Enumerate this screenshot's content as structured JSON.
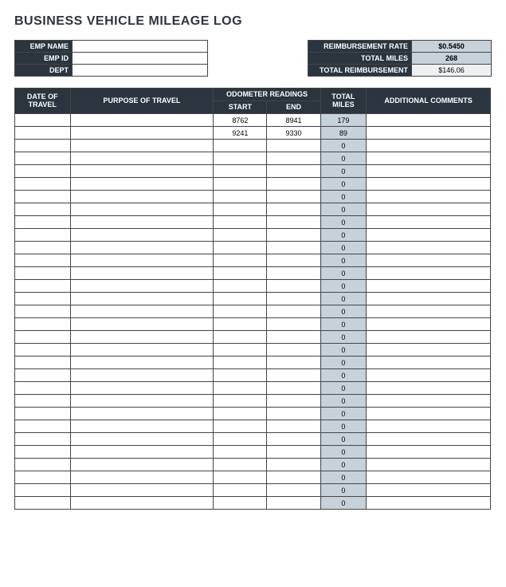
{
  "title": "BUSINESS VEHICLE MILEAGE LOG",
  "emp": {
    "name_label": "EMP NAME",
    "id_label": "EMP ID",
    "dept_label": "DEPT",
    "name": "",
    "id": "",
    "dept": ""
  },
  "reimb": {
    "rate_label": "REIMBURSEMENT RATE",
    "miles_label": "TOTAL MILES",
    "total_label": "TOTAL REIMBURSEMENT",
    "rate": "$0.5450",
    "miles": "268",
    "total": "$146.06"
  },
  "headers": {
    "date": "DATE OF TRAVEL",
    "purpose": "PURPOSE OF TRAVEL",
    "odo": "ODOMETER READINGS",
    "start": "START",
    "end": "END",
    "tmiles": "TOTAL MILES",
    "comments": "ADDITIONAL COMMENTS"
  },
  "rows": [
    {
      "date": "",
      "purpose": "",
      "start": "8762",
      "end": "8941",
      "miles": "179",
      "comments": ""
    },
    {
      "date": "",
      "purpose": "",
      "start": "9241",
      "end": "9330",
      "miles": "89",
      "comments": ""
    },
    {
      "date": "",
      "purpose": "",
      "start": "",
      "end": "",
      "miles": "0",
      "comments": ""
    },
    {
      "date": "",
      "purpose": "",
      "start": "",
      "end": "",
      "miles": "0",
      "comments": ""
    },
    {
      "date": "",
      "purpose": "",
      "start": "",
      "end": "",
      "miles": "0",
      "comments": ""
    },
    {
      "date": "",
      "purpose": "",
      "start": "",
      "end": "",
      "miles": "0",
      "comments": ""
    },
    {
      "date": "",
      "purpose": "",
      "start": "",
      "end": "",
      "miles": "0",
      "comments": ""
    },
    {
      "date": "",
      "purpose": "",
      "start": "",
      "end": "",
      "miles": "0",
      "comments": ""
    },
    {
      "date": "",
      "purpose": "",
      "start": "",
      "end": "",
      "miles": "0",
      "comments": ""
    },
    {
      "date": "",
      "purpose": "",
      "start": "",
      "end": "",
      "miles": "0",
      "comments": ""
    },
    {
      "date": "",
      "purpose": "",
      "start": "",
      "end": "",
      "miles": "0",
      "comments": ""
    },
    {
      "date": "",
      "purpose": "",
      "start": "",
      "end": "",
      "miles": "0",
      "comments": ""
    },
    {
      "date": "",
      "purpose": "",
      "start": "",
      "end": "",
      "miles": "0",
      "comments": ""
    },
    {
      "date": "",
      "purpose": "",
      "start": "",
      "end": "",
      "miles": "0",
      "comments": ""
    },
    {
      "date": "",
      "purpose": "",
      "start": "",
      "end": "",
      "miles": "0",
      "comments": ""
    },
    {
      "date": "",
      "purpose": "",
      "start": "",
      "end": "",
      "miles": "0",
      "comments": ""
    },
    {
      "date": "",
      "purpose": "",
      "start": "",
      "end": "",
      "miles": "0",
      "comments": ""
    },
    {
      "date": "",
      "purpose": "",
      "start": "",
      "end": "",
      "miles": "0",
      "comments": ""
    },
    {
      "date": "",
      "purpose": "",
      "start": "",
      "end": "",
      "miles": "0",
      "comments": ""
    },
    {
      "date": "",
      "purpose": "",
      "start": "",
      "end": "",
      "miles": "0",
      "comments": ""
    },
    {
      "date": "",
      "purpose": "",
      "start": "",
      "end": "",
      "miles": "0",
      "comments": ""
    },
    {
      "date": "",
      "purpose": "",
      "start": "",
      "end": "",
      "miles": "0",
      "comments": ""
    },
    {
      "date": "",
      "purpose": "",
      "start": "",
      "end": "",
      "miles": "0",
      "comments": ""
    },
    {
      "date": "",
      "purpose": "",
      "start": "",
      "end": "",
      "miles": "0",
      "comments": ""
    },
    {
      "date": "",
      "purpose": "",
      "start": "",
      "end": "",
      "miles": "0",
      "comments": ""
    },
    {
      "date": "",
      "purpose": "",
      "start": "",
      "end": "",
      "miles": "0",
      "comments": ""
    },
    {
      "date": "",
      "purpose": "",
      "start": "",
      "end": "",
      "miles": "0",
      "comments": ""
    },
    {
      "date": "",
      "purpose": "",
      "start": "",
      "end": "",
      "miles": "0",
      "comments": ""
    },
    {
      "date": "",
      "purpose": "",
      "start": "",
      "end": "",
      "miles": "0",
      "comments": ""
    },
    {
      "date": "",
      "purpose": "",
      "start": "",
      "end": "",
      "miles": "0",
      "comments": ""
    },
    {
      "date": "",
      "purpose": "",
      "start": "",
      "end": "",
      "miles": "0",
      "comments": ""
    }
  ]
}
